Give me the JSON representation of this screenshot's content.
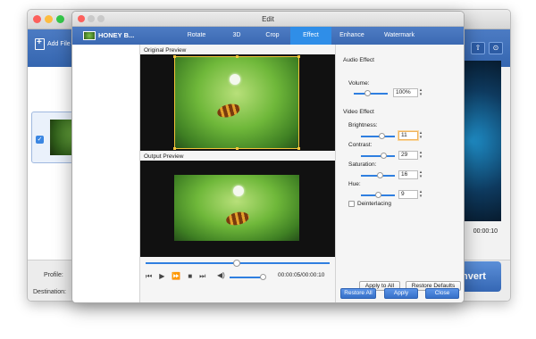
{
  "back_window": {
    "add_file_label": "Add File",
    "profile_label": "Profile:",
    "destination_label": "Destination:",
    "convert_label": "nvert",
    "time": "00:00:10"
  },
  "edit": {
    "title": "Edit",
    "clip_name": "HONEY B...",
    "tabs": [
      "Rotate",
      "3D",
      "Crop",
      "Effect",
      "Enhance",
      "Watermark"
    ],
    "active_tab": "Effect",
    "original_preview_label": "Original Preview",
    "output_preview_label": "Output Preview",
    "timecode": "00:00:05/00:00:10"
  },
  "audio": {
    "heading": "Audio Effect",
    "volume_label": "Volume:",
    "volume_value": "100%"
  },
  "video": {
    "heading": "Video Effect",
    "brightness_label": "Brightness:",
    "brightness_value": "11",
    "contrast_label": "Contrast:",
    "contrast_value": "29",
    "saturation_label": "Saturation:",
    "saturation_value": "16",
    "hue_label": "Hue:",
    "hue_value": "9",
    "deinterlacing_label": "Deinterlacing"
  },
  "buttons": {
    "apply_to_all": "Apply to All",
    "restore_defaults": "Restore Defaults",
    "restore_all": "Restore All",
    "apply": "Apply",
    "close": "Close"
  },
  "colors": {
    "accent_blue": "#3b69b2",
    "active_tab": "#2f8ee8",
    "focus_orange": "#f0b35b"
  }
}
